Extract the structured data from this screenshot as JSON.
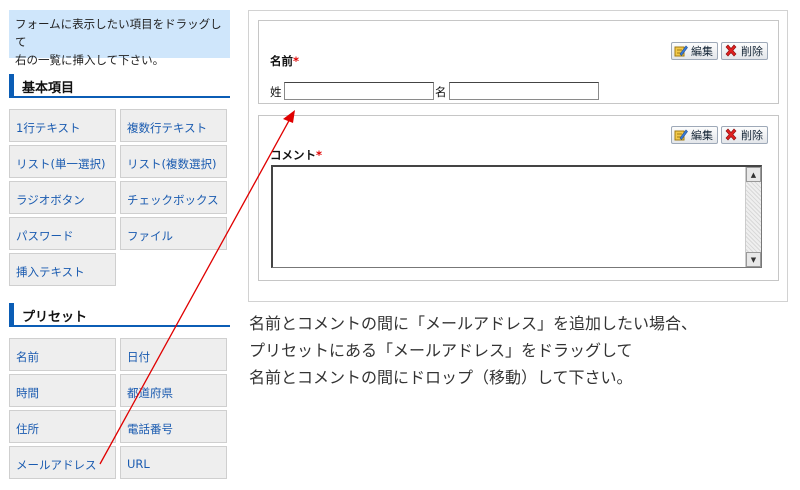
{
  "hint": "フォームに表示したい項目をドラッグして右の一覧に挿入して下さい。",
  "hint_lines": [
    "フォームに表示したい項目をドラッグして",
    "右の一覧に挿入して下さい。"
  ],
  "basic": {
    "title": "基本項目",
    "items": [
      "1行テキスト",
      "複数行テキスト",
      "リスト(単一選択)",
      "リスト(複数選択)",
      "ラジオボタン",
      "チェックボックス",
      "パスワード",
      "ファイル",
      "挿入テキスト"
    ]
  },
  "preset": {
    "title": "プリセット",
    "items": [
      "名前",
      "日付",
      "時間",
      "都道府県",
      "住所",
      "電話番号",
      "メールアドレス",
      "URL"
    ]
  },
  "form": {
    "edit_label": "編集",
    "delete_label": "削除",
    "name_field": {
      "label": "名前",
      "required_mark": "*",
      "last_label": "姓",
      "first_label": "名"
    },
    "comment_field": {
      "label": "コメント",
      "required_mark": "*"
    }
  },
  "description": [
    "名前とコメントの間に「メールアドレス」を追加したい場合、",
    "プリセットにある「メールアドレス」をドラッグして",
    "名前とコメントの間にドロップ（移動）して下さい。"
  ],
  "colors": {
    "accent": "#0b5db5",
    "required": "#e00000",
    "arrow": "#e00000",
    "hint_bg": "#cfe6fb"
  }
}
